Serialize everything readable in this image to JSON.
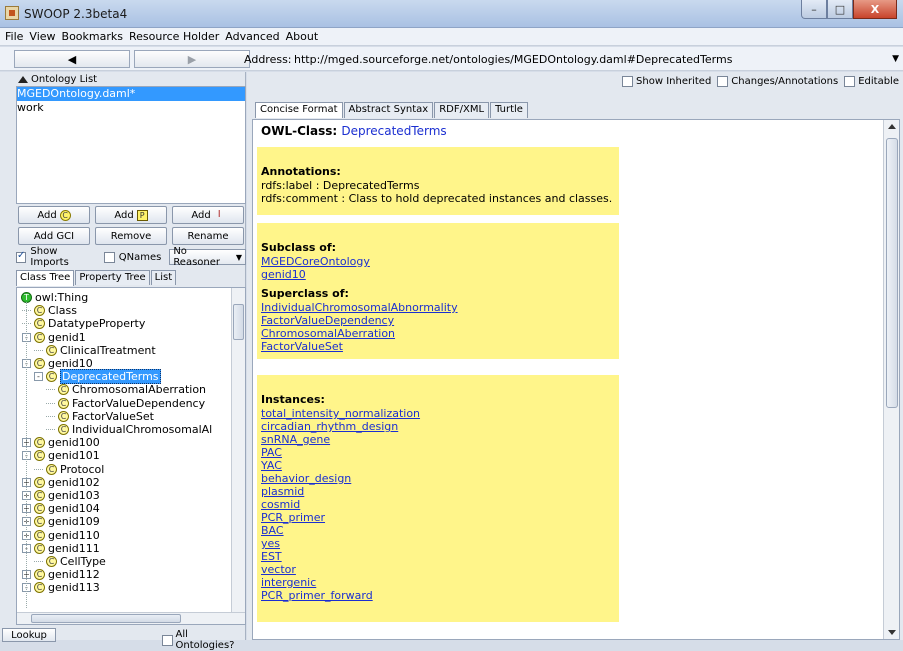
{
  "window": {
    "title": "SWOOP 2.3beta4",
    "controls": {
      "minimize": "–",
      "maximize": "□",
      "close": "X"
    }
  },
  "menu": [
    "File",
    "View",
    "Bookmarks",
    "Resource Holder",
    "Advanced",
    "About"
  ],
  "nav": {
    "back": "◀",
    "forward": "▶",
    "address_label": "Address:",
    "address_value": "http://mged.sourceforge.net/ontologies/MGEDOntology.daml#DeprecatedTerms"
  },
  "ontology_list": {
    "header": "Ontology List",
    "items": [
      {
        "label": "MGEDOntology.daml*",
        "selected": true
      },
      {
        "label": "work",
        "selected": false
      }
    ]
  },
  "buttons": {
    "add_class": "Add",
    "add_property": "Add",
    "add_individual": "Add",
    "class_glyph": "C",
    "property_glyph": "P",
    "individual_glyph": "I",
    "add_gci": "Add GCI",
    "remove": "Remove",
    "rename": "Rename"
  },
  "options": {
    "show_imports": "Show Imports",
    "show_imports_checked": true,
    "qnames": "QNames",
    "qnames_checked": false,
    "reasoner": "No Reasoner"
  },
  "left_tabs": [
    "Class Tree",
    "Property Tree",
    "List"
  ],
  "tree": [
    {
      "label": "owl:Thing",
      "icon": "thing-icon",
      "depth": 0,
      "expander": ""
    },
    {
      "label": "Class",
      "icon": "class-icon",
      "depth": 1,
      "expander": ""
    },
    {
      "label": "DatatypeProperty",
      "icon": "class-icon",
      "depth": 1,
      "expander": ""
    },
    {
      "label": "genid1",
      "icon": "class-icon",
      "depth": 1,
      "expander": "-"
    },
    {
      "label": "ClinicalTreatment",
      "icon": "class-icon",
      "depth": 2,
      "expander": ""
    },
    {
      "label": "genid10",
      "icon": "class-icon",
      "depth": 1,
      "expander": "-"
    },
    {
      "label": "DeprecatedTerms",
      "icon": "class-icon",
      "depth": 2,
      "expander": "-",
      "selected": true
    },
    {
      "label": "ChromosomalAberration",
      "icon": "class-icon",
      "depth": 3,
      "expander": ""
    },
    {
      "label": "FactorValueDependency",
      "icon": "class-icon",
      "depth": 3,
      "expander": ""
    },
    {
      "label": "FactorValueSet",
      "icon": "class-icon",
      "depth": 3,
      "expander": ""
    },
    {
      "label": "IndividualChromosomalAl",
      "icon": "class-icon",
      "depth": 3,
      "expander": ""
    },
    {
      "label": "genid100",
      "icon": "class-icon",
      "depth": 1,
      "expander": "+"
    },
    {
      "label": "genid101",
      "icon": "class-icon",
      "depth": 1,
      "expander": "-"
    },
    {
      "label": "Protocol",
      "icon": "class-icon",
      "depth": 2,
      "expander": ""
    },
    {
      "label": "genid102",
      "icon": "class-icon",
      "depth": 1,
      "expander": "+"
    },
    {
      "label": "genid103",
      "icon": "class-icon",
      "depth": 1,
      "expander": "+"
    },
    {
      "label": "genid104",
      "icon": "class-icon",
      "depth": 1,
      "expander": "+"
    },
    {
      "label": "genid109",
      "icon": "class-icon",
      "depth": 1,
      "expander": "+"
    },
    {
      "label": "genid110",
      "icon": "class-icon",
      "depth": 1,
      "expander": "+"
    },
    {
      "label": "genid111",
      "icon": "class-icon",
      "depth": 1,
      "expander": "-"
    },
    {
      "label": "CellType",
      "icon": "class-icon",
      "depth": 2,
      "expander": ""
    },
    {
      "label": "genid112",
      "icon": "class-icon",
      "depth": 1,
      "expander": "+"
    },
    {
      "label": "genid113",
      "icon": "class-icon",
      "depth": 1,
      "expander": "-"
    }
  ],
  "bottom": {
    "lookup": "Lookup",
    "all_ontologies": "All Ontologies?",
    "all_ontologies_checked": false
  },
  "right_options": [
    {
      "label": "Show Inherited",
      "checked": false
    },
    {
      "label": "Changes/Annotations",
      "checked": false
    },
    {
      "label": "Editable",
      "checked": false
    }
  ],
  "right_tabs": [
    "Concise Format",
    "Abstract Syntax",
    "RDF/XML",
    "Turtle"
  ],
  "details": {
    "owl_class_label": "OWL-Class:",
    "owl_class_name": "DeprecatedTerms",
    "annotations_header": "Annotations:",
    "annotations": [
      "rdfs:label : DeprecatedTerms",
      "rdfs:comment : Class to hold deprecated instances and classes."
    ],
    "subclass_header": "Subclass of:",
    "subclass_of": [
      "MGEDCoreOntology",
      "genid10"
    ],
    "superclass_header": "Superclass of:",
    "superclass_of": [
      "IndividualChromosomalAbnormality",
      "FactorValueDependency",
      "ChromosomalAberration",
      "FactorValueSet"
    ],
    "instances_header": "Instances:",
    "instances": [
      "total_intensity_normalization",
      "circadian_rhythm_design",
      "snRNA_gene",
      "PAC",
      "YAC",
      "behavior_design",
      "plasmid",
      "cosmid",
      "PCR_primer",
      "BAC",
      "yes",
      "EST",
      "vector",
      "intergenic",
      "PCR_primer_forward"
    ]
  }
}
